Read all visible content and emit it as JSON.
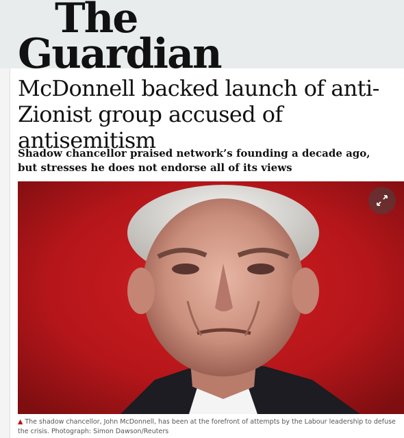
{
  "masthead": {
    "logo_line1": "The",
    "logo_line2": "Guardian"
  },
  "article": {
    "headline": "McDonnell backed launch of anti-Zionist group accused of antisemitism",
    "standfirst": "Shadow chancellor praised network’s founding a decade ago, but stresses he does not endorse all of its views",
    "caption_marker": "▲",
    "caption": "The shadow chancellor, John McDonnell, has been at the forefront of attempts by the Labour leadership to defuse the crisis. Photograph: Simon Dawson/Reuters"
  },
  "icons": {
    "expand": "expand-arrows-icon",
    "caption_marker": "triangle-up-icon"
  },
  "colors": {
    "photo_background": "#c0171c",
    "caption_marker": "#c70000",
    "masthead_background": "#e8ecec"
  }
}
